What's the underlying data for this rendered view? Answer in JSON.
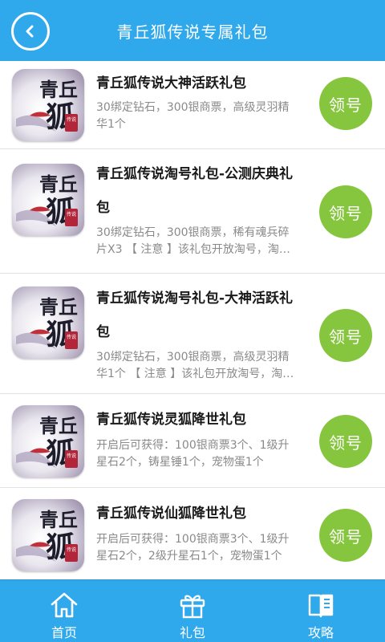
{
  "header": {
    "title": "青丘狐传说专属礼包"
  },
  "button_label": "领号",
  "thumb_text": {
    "line1": "青丘",
    "line2": "狐",
    "seal": "传说"
  },
  "gifts": [
    {
      "title": "青丘狐传说大神活跃礼包",
      "desc": "30绑定钻石，300银商票，高级灵羽精华1个"
    },
    {
      "title": "青丘狐传说淘号礼包-公测庆典礼包",
      "desc": "30绑定钻石，300银商票，稀有魂兵碎片X3 【 注意 】该礼包开放淘号，淘号后可能无法使用"
    },
    {
      "title": "青丘狐传说淘号礼包-大神活跃礼包",
      "desc": "30绑定钻石，300银商票，高级灵羽精华1个 【 注意 】该礼包开放淘号，淘号后可能无法使用"
    },
    {
      "title": "青丘狐传说灵狐降世礼包",
      "desc": "开启后可获得：100银商票3个、1级升星石2个，铸星锤1个，宠物蛋1个"
    },
    {
      "title": "青丘狐传说仙狐降世礼包",
      "desc": "开启后可获得：100银商票3个、1级升星石2个，2级升星石1个，宠物蛋1个"
    }
  ],
  "bottom_nav": {
    "items": [
      {
        "label": "首页",
        "icon": "home-icon"
      },
      {
        "label": "礼包",
        "icon": "gift-icon"
      },
      {
        "label": "攻略",
        "icon": "book-icon"
      }
    ]
  },
  "colors": {
    "header_bg": "#2fa8ec",
    "button_green": "#86c63f",
    "title_text": "#1a1a1a",
    "desc_text": "#8a8a8a"
  }
}
